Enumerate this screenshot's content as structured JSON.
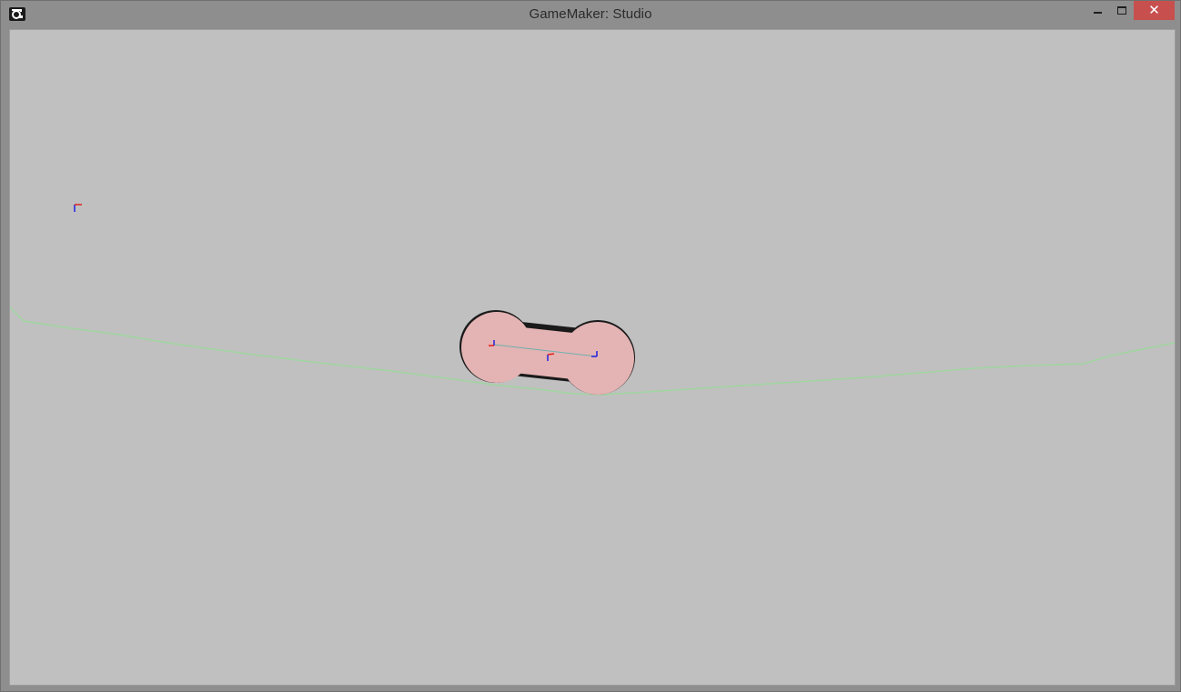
{
  "window": {
    "title": "GameMaker: Studio",
    "buttons": {
      "minimize_icon": "minimize-icon",
      "maximize_icon": "maximize-icon",
      "close_icon": "close-icon",
      "close_glyph": "✕"
    },
    "colors": {
      "titlebar": "#8e8e8e",
      "close_button": "#c7504f",
      "canvas_background": "#c0c0c0"
    }
  },
  "scene": {
    "colors": {
      "terrain_line": "#9fd59f",
      "body_fill": "#e4b3b3",
      "body_edge": "#1a1a1a",
      "axis_red": "#e02020",
      "axis_blue": "#2020e0",
      "joint_line": "#6fb0b0"
    },
    "objects": [
      "terrain-line",
      "dumbbell-body",
      "left-wheel",
      "right-wheel",
      "origin-marker"
    ]
  }
}
